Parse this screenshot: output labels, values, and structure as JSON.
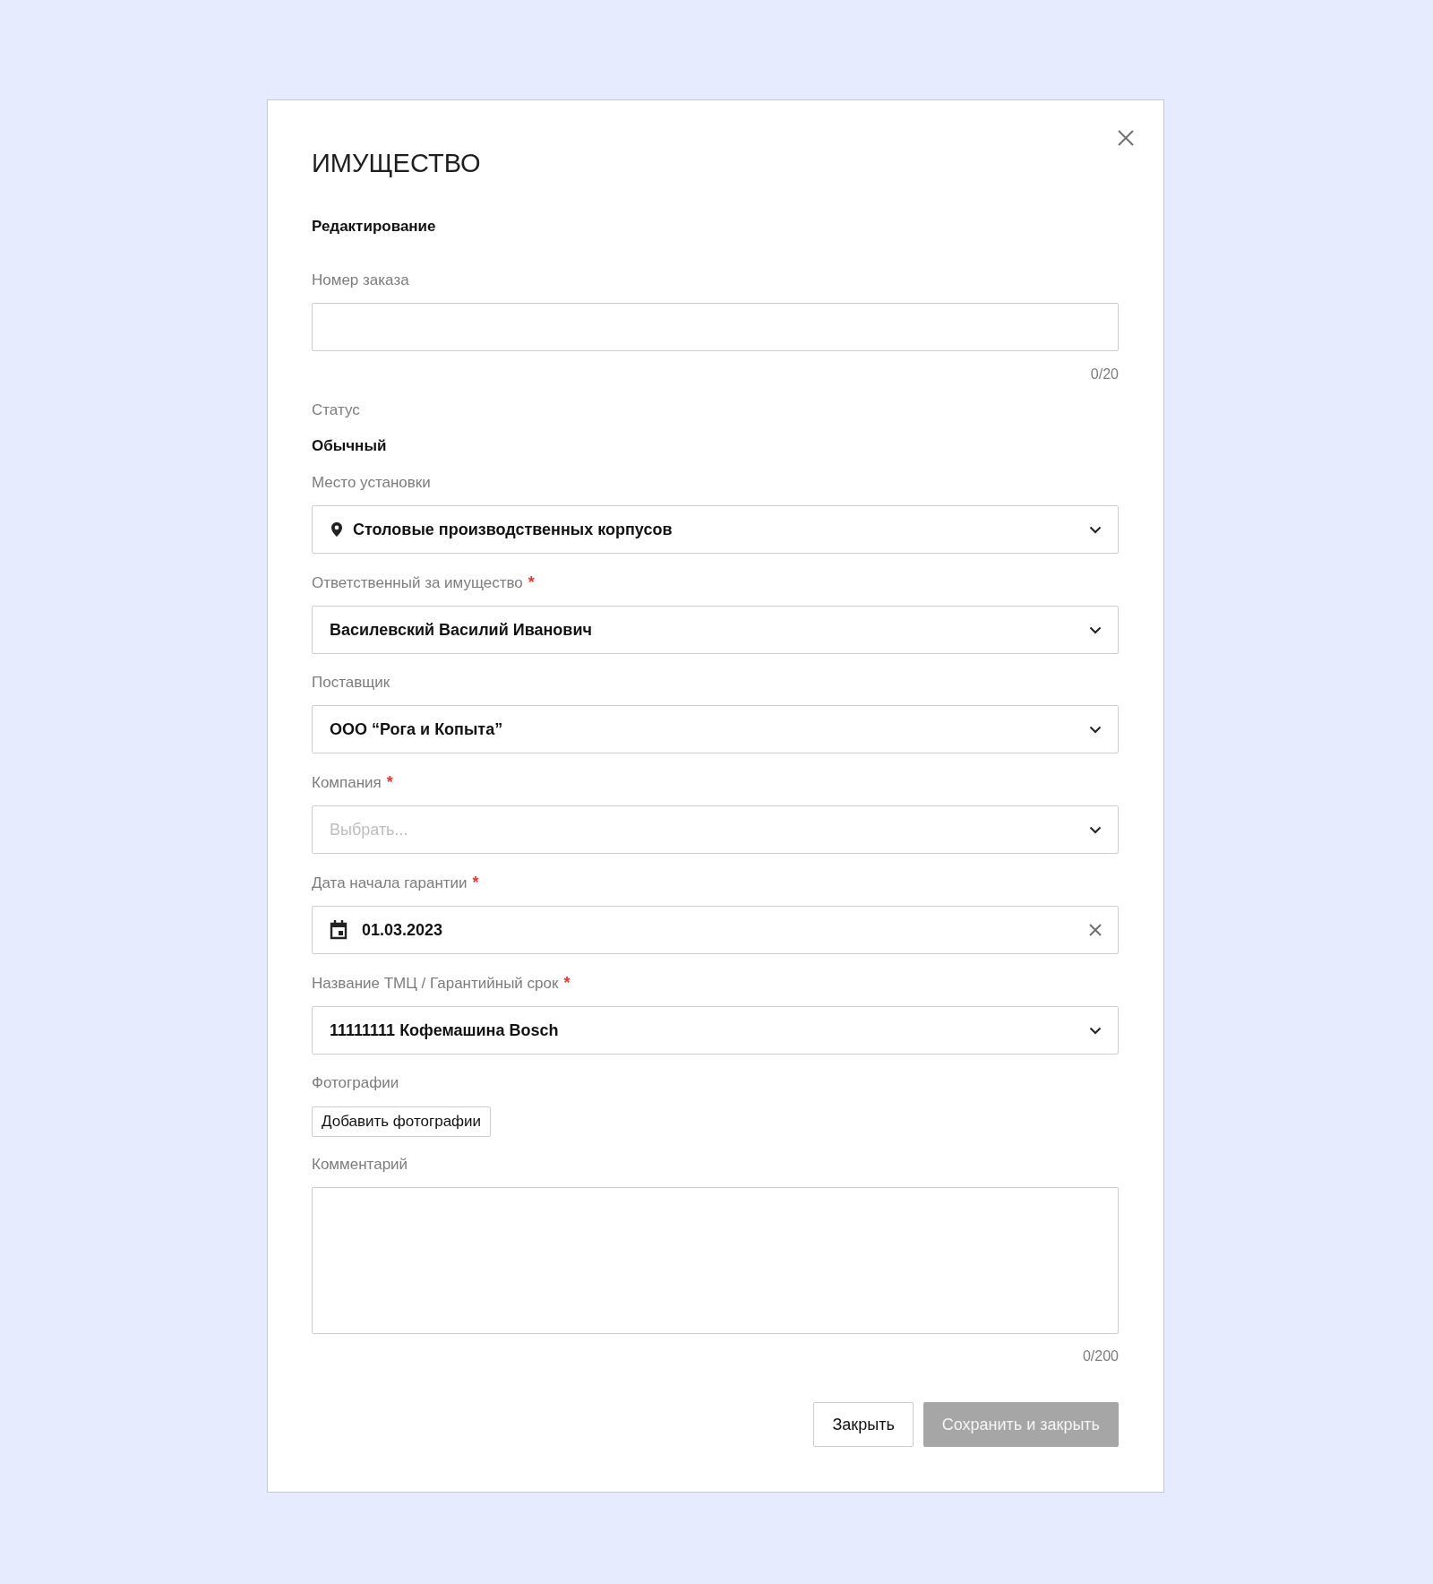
{
  "dialog": {
    "title": "ИМУЩЕСТВО",
    "subtitle": "Редактирование"
  },
  "fields": [
    {
      "kind": "text",
      "label": "Номер заказа",
      "counter": "0/20"
    },
    {
      "kind": "static",
      "label": "Статус",
      "value": "Обычный"
    },
    {
      "kind": "location",
      "label": "Место установки",
      "value": "Столовые производственных корпусов"
    },
    {
      "kind": "select",
      "label": "Ответственный за имущество",
      "required_mark": "*",
      "value": "Василевский Василий Иванович"
    },
    {
      "kind": "select",
      "label": "Поставщик",
      "value": "ООО “Рога и Копыта”"
    },
    {
      "kind": "select",
      "label": "Компания",
      "required_mark": "*",
      "placeholder": "Выбрать..."
    },
    {
      "kind": "date",
      "label": "Дата начала гарантии",
      "required_mark": "*",
      "value": "01.03.2023"
    },
    {
      "kind": "select",
      "label": "Название ТМЦ / Гарантийный срок",
      "required_mark": "*",
      "value": "11111111 Кофемашина Bosch"
    },
    {
      "kind": "upload",
      "label": "Фотографии",
      "button": "Добавить фотографии"
    },
    {
      "kind": "textarea",
      "label": "Комментарий",
      "counter": "0/200"
    }
  ],
  "buttons": [
    {
      "kind": "secondary",
      "label": "Закрыть",
      "disabled": false
    },
    {
      "kind": "primary",
      "label": "Сохранить и закрыть",
      "disabled": true
    }
  ]
}
